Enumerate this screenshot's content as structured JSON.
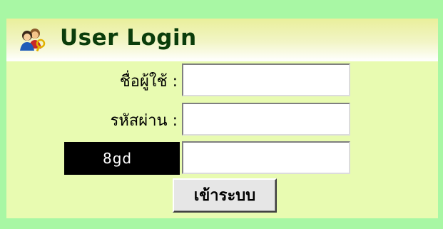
{
  "login": {
    "title": "User Login",
    "icon": "users-key-icon",
    "username_label": "ชื่อผู้ใช้ :",
    "username_value": "",
    "password_label": "รหัสผ่าน :",
    "password_value": "",
    "captcha_text": "8gd",
    "captcha_value": "",
    "submit_label": "เข้าระบบ"
  },
  "colors": {
    "page_background": "#a8f7a4",
    "panel_background": "#e8fbb1",
    "title_color": "#0b3d0b",
    "captcha_background": "#000000"
  }
}
